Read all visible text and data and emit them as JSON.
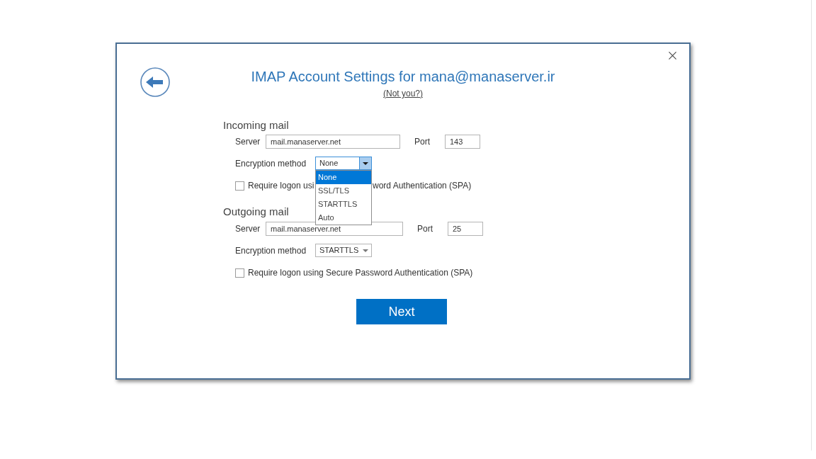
{
  "dialog": {
    "title": "IMAP Account Settings for mana@manaserver.ir",
    "link": "(Not you?)"
  },
  "sections": [
    {
      "heading": "Incoming mail",
      "server_label": "Server",
      "server": "mail.manaserver.net",
      "port_label": "Port",
      "port": "143",
      "encryption_label": "Encryption method",
      "encryption": "None",
      "expanded": true,
      "options": [
        {
          "label": "None",
          "selected": true
        },
        {
          "label": "SSL/TLS",
          "selected": false
        },
        {
          "label": "STARTTLS",
          "selected": false
        },
        {
          "label": "Auto",
          "selected": false
        }
      ],
      "spa_checked": false,
      "spa_label_parts": [
        "Require logon usi",
        "word Authentication (SPA)"
      ]
    },
    {
      "heading": "Outgoing mail",
      "server_label": "Server",
      "server": "mail.manaserver.net",
      "port_label": "Port",
      "port": "25",
      "encryption_label": "Encryption method",
      "encryption": "STARTTLS",
      "expanded": false,
      "spa_checked": false,
      "spa_label_parts": [
        "Require logon using Secure Password Authentication (SPA)"
      ]
    }
  ],
  "next_button": "Next"
}
